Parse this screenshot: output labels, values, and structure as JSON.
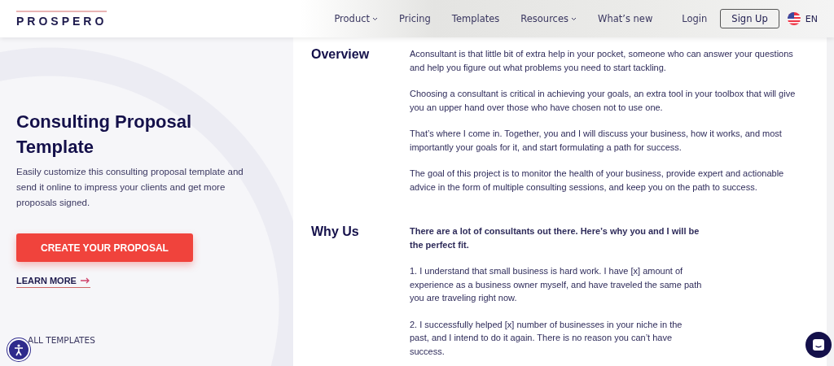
{
  "header": {
    "logo": "PROSPERO",
    "nav": [
      {
        "label": "Product",
        "has_menu": true
      },
      {
        "label": "Pricing",
        "has_menu": false
      },
      {
        "label": "Templates",
        "has_menu": false
      },
      {
        "label": "Resources",
        "has_menu": true
      },
      {
        "label": "What’s new",
        "has_menu": false
      }
    ],
    "login": "Login",
    "signup": "Sign Up",
    "language": "EN"
  },
  "hero": {
    "title": "Consulting Proposal Template",
    "description": "Easily customize this consulting proposal template and send it online to impress your clients and get more proposals signed.",
    "cta": "CREATE YOUR PROPOSAL",
    "learn_more": "LEARN MORE",
    "all_templates": "ALL TEMPLATES"
  },
  "document": {
    "sections": [
      {
        "heading": "Overview",
        "paragraphs": [
          {
            "text": "Aconsultant is that little bit of extra help in your pocket, someone who can answer your questions and help you figure out what problems you need to start tackling.",
            "bold": false
          },
          {
            "text": "Choosing a consultant is critical in achieving your goals, an extra tool in your toolbox that will give you an upper hand over those who have chosen not to use one.",
            "bold": false
          },
          {
            "text": "That’s where I come in. Together, you and I will discuss your business, how it works, and most importantly your goals for it, and start formulating a path for success.",
            "bold": false
          },
          {
            "text": "The goal of this project is to monitor the health of your business, provide expert and actionable advice in the form of multiple consulting sessions, and keep you on the path to success.",
            "bold": false
          }
        ]
      },
      {
        "heading": "Why Us",
        "paragraphs": [
          {
            "text": "There are a lot of consultants out there. Here’s why you and I will be the perfect fit.",
            "bold": true
          },
          {
            "text": "1. I understand that small business is hard work. I have [x] amount of experience as a business owner myself, and have traveled the same path you are traveling right now.",
            "bold": false
          },
          {
            "text": "2. I successfully helped [x] number of businesses in your niche in the past, and I intend to do it again. There is no reason you can’t have success.",
            "bold": false
          }
        ]
      }
    ]
  }
}
